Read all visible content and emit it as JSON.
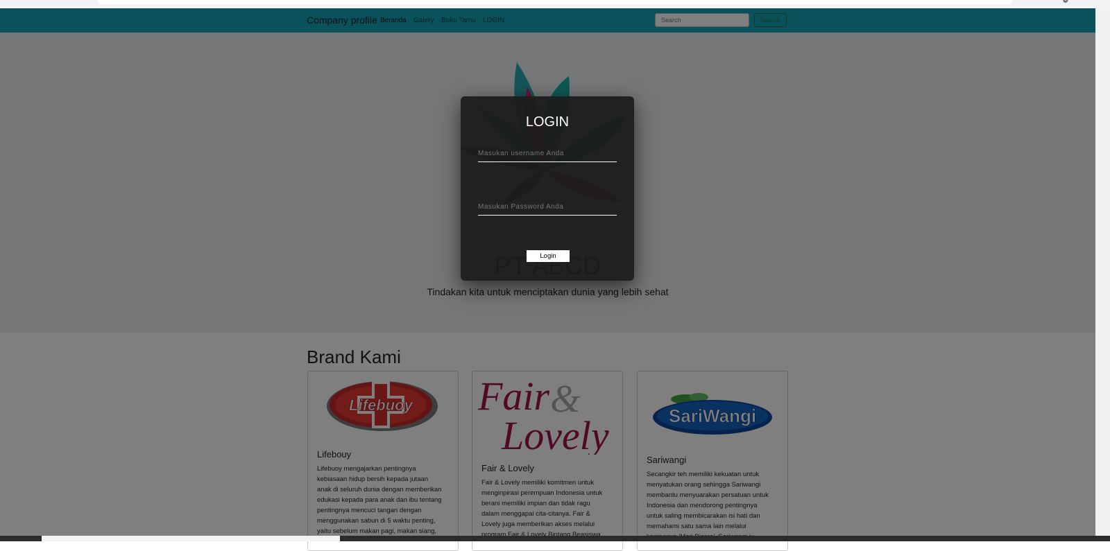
{
  "navbar": {
    "brand": "Company profile",
    "links": [
      {
        "label": "Beranda",
        "active": true
      },
      {
        "label": "Galery",
        "active": false
      },
      {
        "label": "Buku Tamu",
        "active": false
      },
      {
        "label": "LOGIN",
        "active": false
      }
    ],
    "search_placeholder": "Search",
    "search_button": "Search",
    "color": "#17a2b8"
  },
  "hero": {
    "title": "PT ABCD",
    "subtitle": "Tindakan kita untuk menciptakan dunia yang lebih sehat",
    "logo_icon": "flower-logo-icon"
  },
  "brands": {
    "title": "Brand Kami",
    "cards": [
      {
        "logo_icon": "lifebuoy-logo",
        "logo_text": "Lifebuoy",
        "name": "Lifebouy",
        "text_lines": [
          "Lifebuoy mengajarkan pentingnya",
          "kebiasaan hidup bersih kepada jutaan",
          "anak di seluruh dunia dengan memberikan",
          "edukasi kepada para anak dan ibu tentang",
          "pentingnya mencuci tangan dengan",
          "menggunakan sabun di 5 waktu penting,",
          "yaitu sebelum makan pagi, makan siang,"
        ]
      },
      {
        "logo_icon": "fair-lovely-logo",
        "logo_text": [
          "Fair",
          "&",
          "Lovely"
        ],
        "name": "Fair & Lovely",
        "text_lines": [
          "Fair & Lovely memiliki komitmen untuk",
          "menginpirasi perempuan Indonesia untuk",
          "berani memiliki impian dan tidak ragu",
          "dalam menggapai cita-citanya. Fair &",
          "Lovely juga memberikan akses melalui",
          "program Fair & Lovely Bintang Beasiswa"
        ]
      },
      {
        "logo_icon": "sariwangi-logo",
        "logo_text": "SariWangi",
        "name": "Sariwangi",
        "text_lines": [
          "Secangkir teh memiliki kekuatan untuk",
          "menyatukan orang sehingga Sariwangi",
          "membantu menyuarakan persatuan untuk",
          "Indonesia dan mendorong pentingnya",
          "untuk saling membicarakan isi hati dan",
          "memahami satu sama lain melalui",
          "kampanye 'Mari Bicara'. Sariwangi ju..."
        ]
      }
    ]
  },
  "login_modal": {
    "title": "LOGIN",
    "username_placeholder": "Masukan username Anda",
    "password_placeholder": "Masukan Password Anda",
    "button": "Login"
  }
}
